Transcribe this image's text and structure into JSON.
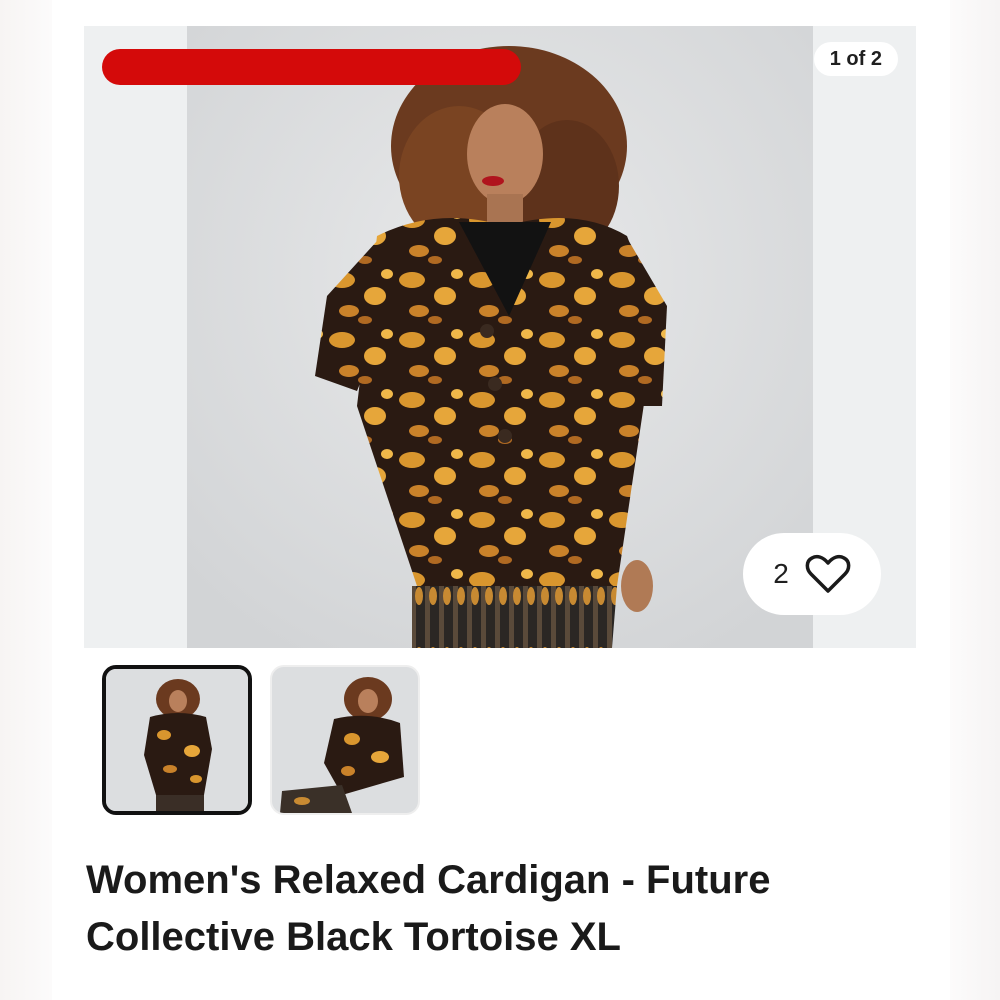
{
  "gallery": {
    "counter_text": "1 of 2",
    "like_count": "2",
    "images": [
      {
        "name": "main-product-photo",
        "active": true
      },
      {
        "name": "secondary-product-photo",
        "active": false
      }
    ]
  },
  "product": {
    "title": "Women's Relaxed Cardigan - Future Collective Black Tortoise XL"
  },
  "icons": {
    "like": "heart-icon"
  },
  "colors": {
    "redaction": "#d40a0a",
    "text": "#1a1a1a",
    "active_thumb_border": "#111111"
  }
}
